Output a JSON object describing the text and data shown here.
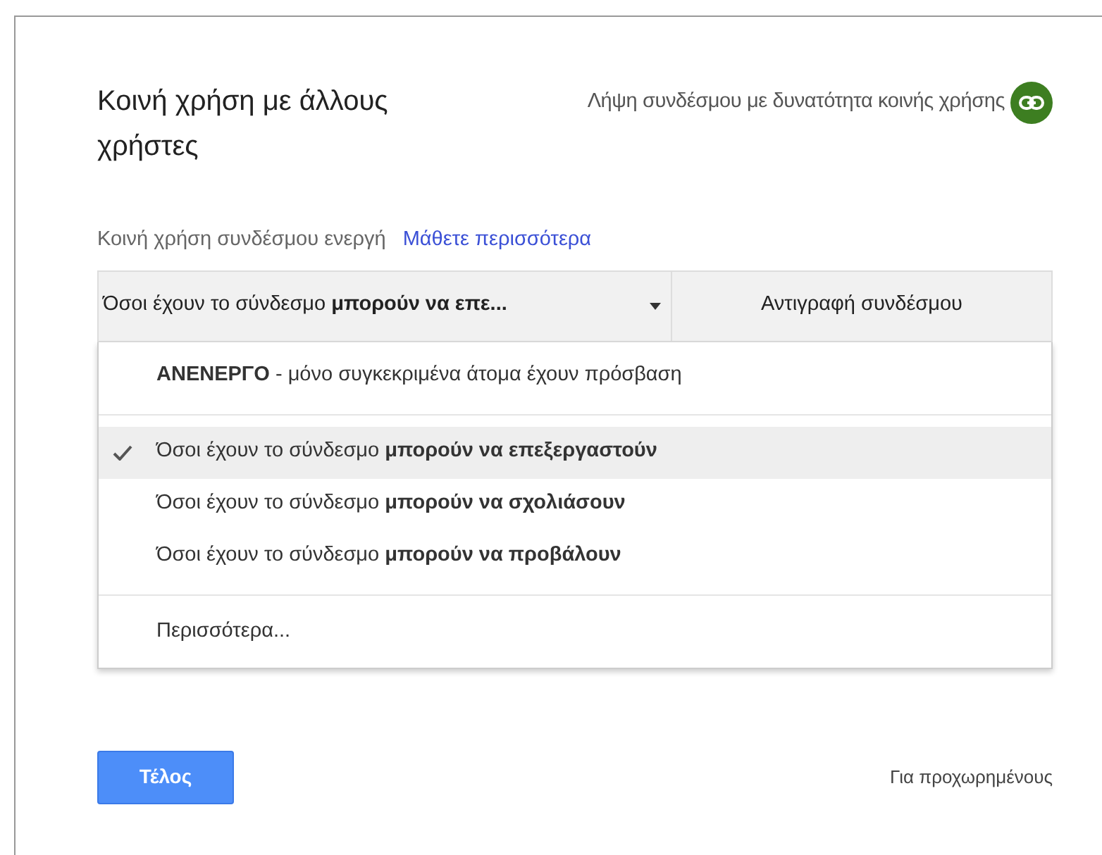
{
  "dialog": {
    "title": "Κοινή χρήση με άλλους χρήστες",
    "get_link": "Λήψη συνδέσμου με δυνατότητα κοινής χρήσης"
  },
  "link_sharing": {
    "status": "Κοινή χρήση συνδέσμου ενεργή",
    "learn_more": "Μάθετε περισσότερα"
  },
  "access_select": {
    "value": "Όσοι έχουν το σύνδεσμο **μπορούν να επε...**",
    "expanded": true
  },
  "copy_button": "Αντιγραφή συνδέσμου",
  "menu": [
    [
      {
        "label": "**ΑΝΕΝΕΡΓΟ** - μόνο συγκεκριμένα άτομα έχουν πρόσβαση",
        "selected": false
      }
    ],
    [
      {
        "label": "Όσοι έχουν το σύνδεσμο **μπορούν να επεξεργαστούν**",
        "selected": true
      },
      {
        "label": "Όσοι έχουν το σύνδεσμο **μπορούν να σχολιάσουν**",
        "selected": false
      },
      {
        "label": "Όσοι έχουν το σύνδεσμο **μπορούν να προβάλουν**",
        "selected": false
      }
    ],
    [
      {
        "label": "Περισσότερα...",
        "selected": false
      }
    ]
  ],
  "done_button": "Τέλος",
  "advanced_link": "Για προχωρημένους"
}
